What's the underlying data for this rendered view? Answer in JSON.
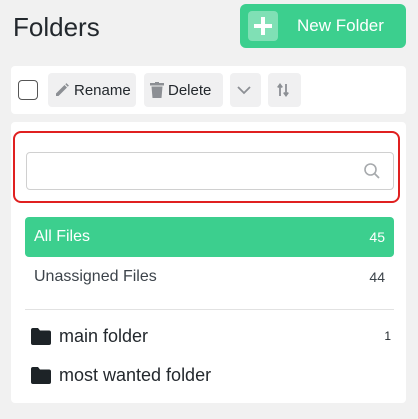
{
  "header": {
    "title": "Folders",
    "new_folder_label": "New Folder"
  },
  "toolbar": {
    "rename_label": "Rename",
    "delete_label": "Delete"
  },
  "search": {
    "value": "",
    "placeholder": ""
  },
  "filters": [
    {
      "label": "All Files",
      "count": "45",
      "active": true
    },
    {
      "label": "Unassigned Files",
      "count": "44",
      "active": false
    }
  ],
  "folders": [
    {
      "name": "main folder",
      "count": "1"
    },
    {
      "name": "most wanted folder",
      "count": ""
    }
  ],
  "colors": {
    "accent": "#3ccf8e",
    "highlight": "#e02020"
  }
}
